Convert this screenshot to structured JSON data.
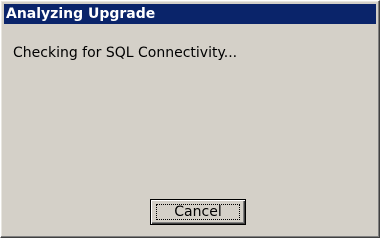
{
  "dialog": {
    "title": "Analyzing Upgrade",
    "message": "Checking for SQL Connectivity...",
    "cancel_label": "Cancel"
  }
}
